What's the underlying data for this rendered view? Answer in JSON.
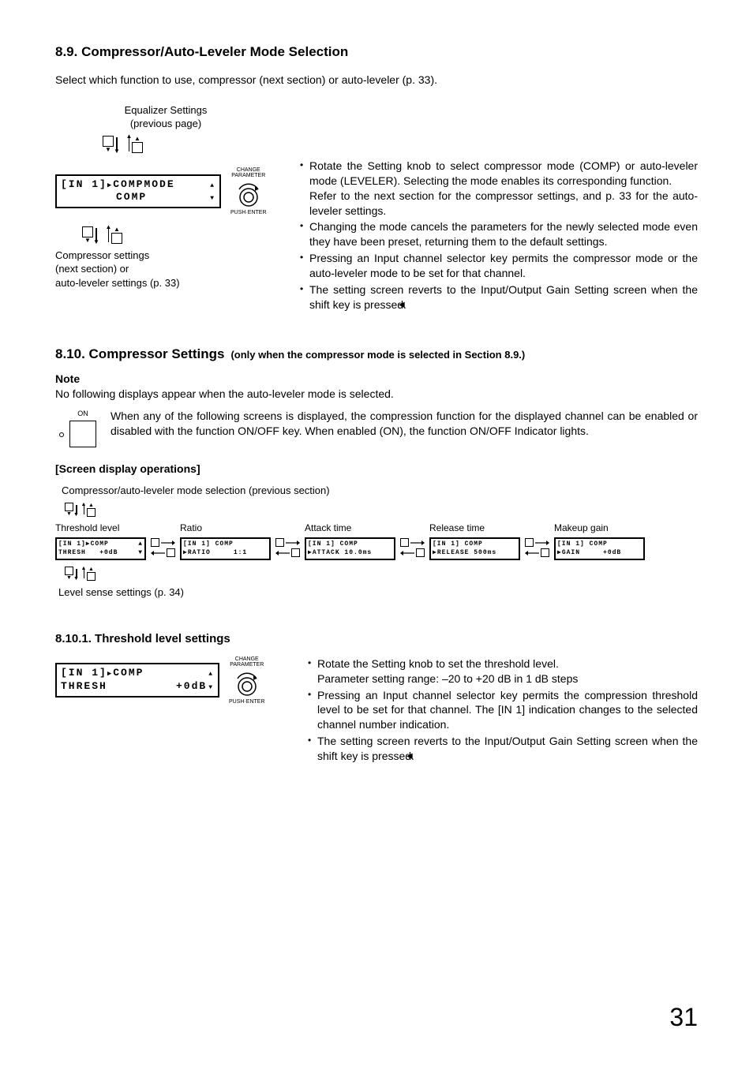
{
  "page_number": "31",
  "s89": {
    "heading": "8.9. Compressor/Auto-Leveler Mode Selection",
    "intro": "Select which function to use, compressor (next section) or auto-leveler (p. 33).",
    "eq_caption_line1": "Equalizer Settings",
    "eq_caption_line2": "(previous page)",
    "lcd_line1_left": "[IN 1]",
    "lcd_line1_right": "COMPMODE",
    "lcd_line2": "COMP",
    "knob_label_top": "CHANGE\nPARAMETER",
    "knob_label_bottom": "PUSH·ENTER",
    "comp_caption_line1": "Compressor settings",
    "comp_caption_line2": "(next section) or",
    "comp_caption_line3": "auto-leveler settings (p. 33)",
    "bullets": [
      "Rotate the Setting knob to select compressor mode (COMP) or auto-leveler mode (LEVELER). Selecting the mode enables its corresponding function.",
      "Changing the mode cancels the parameters for the newly selected mode even they have been preset, returning them to the default settings.",
      "Pressing an Input channel selector key permits the compressor mode or the auto-leveler mode to be set for that channel.",
      "The setting screen reverts to the Input/Output Gain Setting screen when the      shift key is pressed."
    ],
    "bullet1_extra": "Refer to the next section for the compressor settings, and p. 33 for the auto-leveler settings."
  },
  "s810": {
    "heading": "8.10. Compressor Settings",
    "qualifier": "(only when the compressor mode is selected in Section 8.9.)",
    "note_label": "Note",
    "note_text": "No following displays appear when the auto-leveler mode is selected.",
    "led_label": "ON",
    "onoff_text": "When any of the following screens is displayed, the compression function for the displayed channel can be enabled or disabled with the function ON/OFF key. When enabled (ON), the function ON/OFF Indicator lights.",
    "screen_ops": "[Screen display operations]",
    "prev_section_label": "Compressor/auto-leveler mode selection (previous section)",
    "flow": [
      {
        "label": "Threshold level",
        "l1": "[IN 1]▶COMP",
        "l2": "THRESH   +0dB",
        "arrows_up_down": true
      },
      {
        "label": "Ratio",
        "l1": "[IN 1] COMP",
        "l2": "▶RATIO     1:1"
      },
      {
        "label": "Attack time",
        "l1": "[IN 1] COMP",
        "l2": "▶ATTACK 10.0ms"
      },
      {
        "label": "Release time",
        "l1": "[IN 1] COMP",
        "l2": "▶RELEASE 500ms"
      },
      {
        "label": "Makeup gain",
        "l1": "[IN 1] COMP",
        "l2": "▶GAIN     +0dB"
      }
    ],
    "level_sense": "Level sense settings (p. 34)"
  },
  "s8101": {
    "heading": "8.10.1. Threshold level settings",
    "lcd_line1_left": "[IN 1]",
    "lcd_line1_right": "COMP",
    "lcd_line2_left": "THRESH",
    "lcd_line2_right": "+0dB",
    "knob_label_top": "CHANGE\nPARAMETER",
    "knob_label_bottom": "PUSH·ENTER",
    "bullets": [
      "Rotate the Setting knob to set the threshold level.",
      "Pressing an Input channel selector key permits the compression threshold level to be set for that channel. The [IN 1] indication changes to the selected channel number indication.",
      "The setting screen reverts to the Input/Output Gain Setting screen when the      shift key is pressed."
    ],
    "bullet1_extra": "Parameter setting range: –20 to +20 dB in 1 dB steps"
  }
}
